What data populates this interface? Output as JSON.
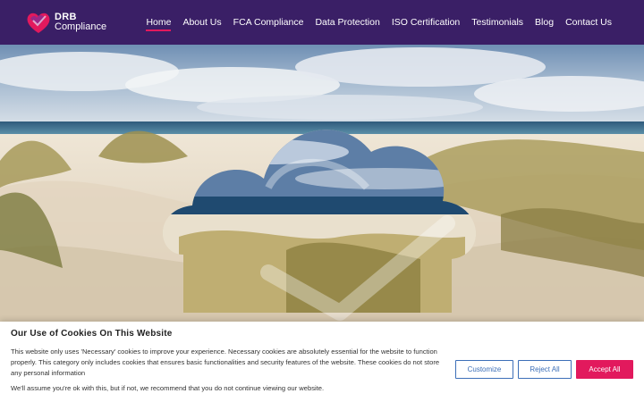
{
  "brand": {
    "logo_line1": "DRB",
    "logo_line2": "Compliance",
    "header_color": "#3a1f66",
    "accent_color": "#e2195d"
  },
  "nav": {
    "items": [
      {
        "label": "Home",
        "active": true
      },
      {
        "label": "About Us"
      },
      {
        "label": "FCA Compliance"
      },
      {
        "label": "Data Protection"
      },
      {
        "label": "ISO Certification"
      },
      {
        "label": "Testimonials"
      },
      {
        "label": "Blog"
      },
      {
        "label": "Contact Us"
      }
    ]
  },
  "hero": {
    "image": "beach-dunes-with-cloud-checkmark-overlay"
  },
  "cookie": {
    "title": "Our Use of Cookies On This Website",
    "body": "This website only uses 'Necessary' cookies to improve your experience. Necessary cookies are absolutely essential for the website to function properly. This category only includes cookies that ensures basic functionalities and security features of the website. These cookies do not store any personal information",
    "note": "We'll assume you're ok with this, but if not, we recommend that you do not continue viewing our website.",
    "customize_label": "Customize",
    "reject_label": "Reject All",
    "accept_label": "Accept All"
  }
}
